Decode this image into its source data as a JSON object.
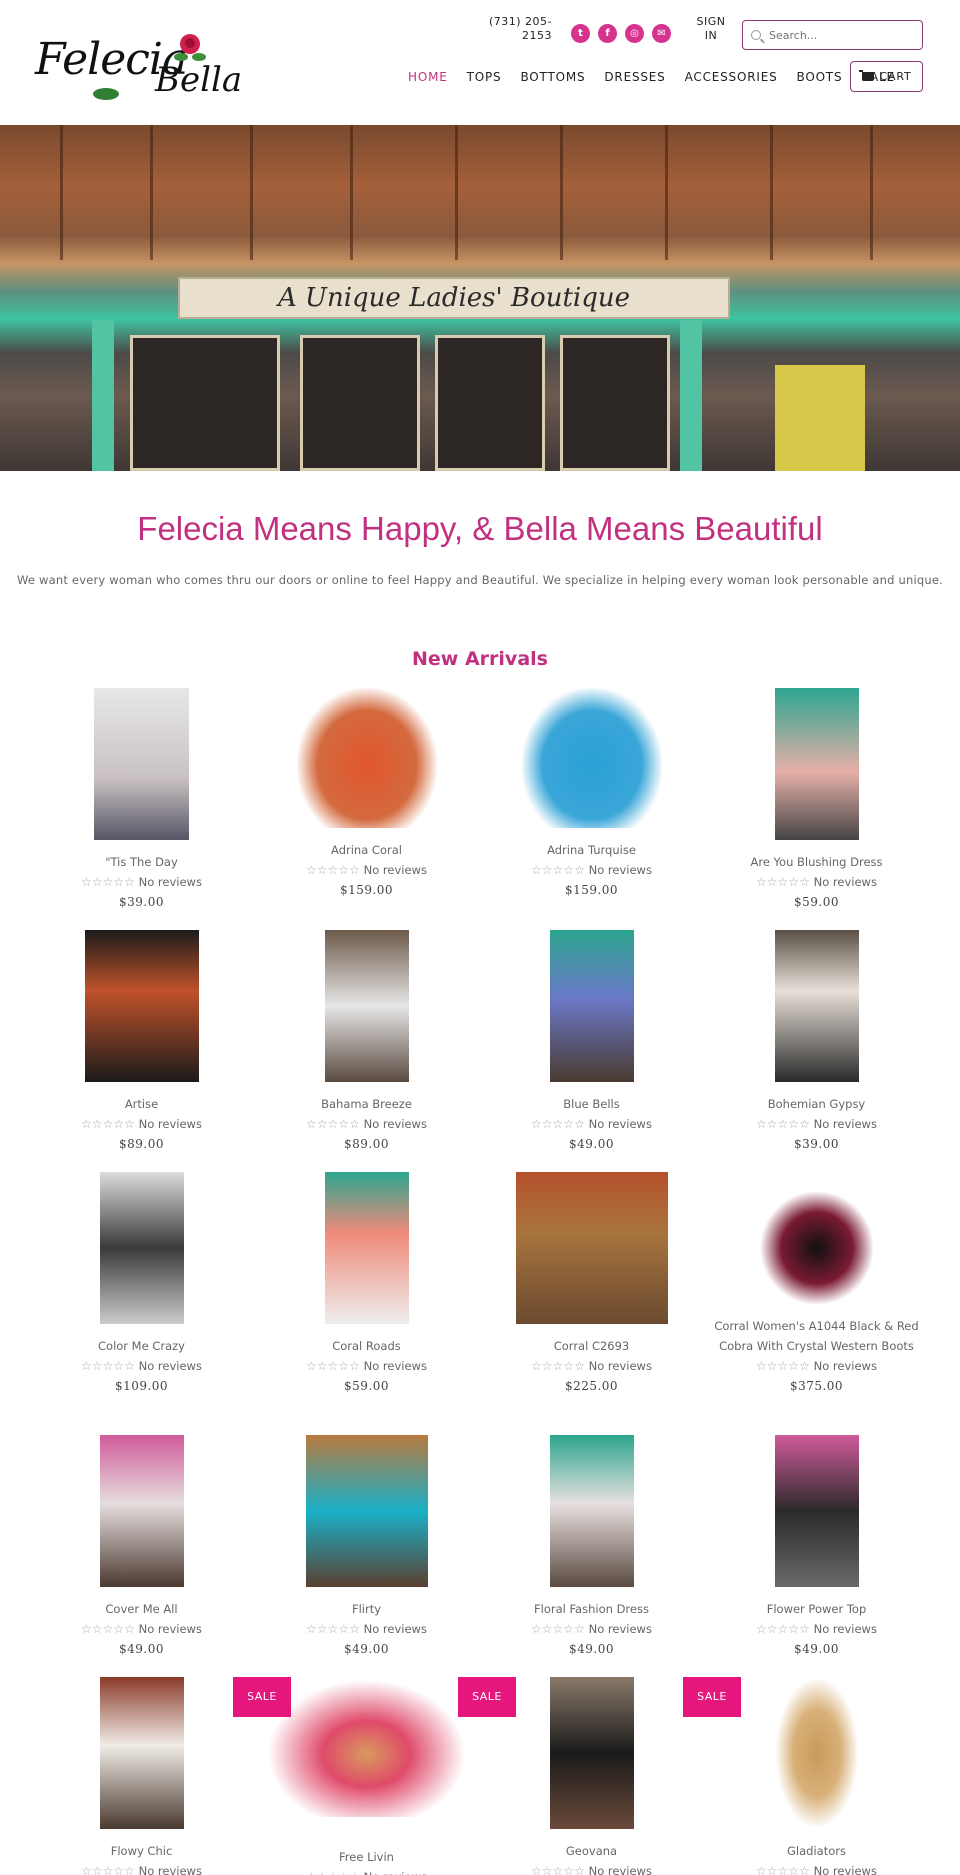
{
  "header": {
    "logo_text_1": "Felecia",
    "logo_text_2": "Bella",
    "phone": "(731) 205-2153",
    "sign_in": "SIGN IN",
    "search_placeholder": "Search...",
    "cart_label": "CART",
    "nav": [
      "HOME",
      "TOPS",
      "BOTTOMS",
      "DRESSES",
      "ACCESSORIES",
      "BOOTS",
      "SALE"
    ]
  },
  "hero": {
    "sign_text": "A Unique Ladies' Boutique"
  },
  "intro": {
    "title": "Felecia Means Happy, & Bella Means Beautiful",
    "text": "We want every woman who comes thru our doors or online to feel Happy and Beautiful. We specialize in helping every woman look personable and unique."
  },
  "section_title": "New Arrivals",
  "review_text": "No reviews",
  "sale_label": "SALE",
  "products": [
    {
      "name": "\"Tis The Day",
      "price": "$39.00",
      "sale": false
    },
    {
      "name": "Adrina Coral",
      "price": "$159.00",
      "sale": false
    },
    {
      "name": "Adrina Turquise",
      "price": "$159.00",
      "sale": false
    },
    {
      "name": "Are You Blushing Dress",
      "price": "$59.00",
      "sale": false
    },
    {
      "name": "Artise",
      "price": "$89.00",
      "sale": false
    },
    {
      "name": "Bahama Breeze",
      "price": "$89.00",
      "sale": false
    },
    {
      "name": "Blue Bells",
      "price": "$49.00",
      "sale": false
    },
    {
      "name": "Bohemian Gypsy",
      "price": "$39.00",
      "sale": false
    },
    {
      "name": "Color Me Crazy",
      "price": "$109.00",
      "sale": false
    },
    {
      "name": "Coral Roads",
      "price": "$59.00",
      "sale": false
    },
    {
      "name": "Corral C2693",
      "price": "$225.00",
      "sale": false
    },
    {
      "name": "Corral Women's A1044 Black & Red Cobra With Crystal Western Boots",
      "price": "$375.00",
      "sale": false
    },
    {
      "name": "Cover Me All",
      "price": "$49.00",
      "sale": false
    },
    {
      "name": "Flirty",
      "price": "$49.00",
      "sale": false
    },
    {
      "name": "Floral Fashion Dress",
      "price": "$49.00",
      "sale": false
    },
    {
      "name": "Flower Power Top",
      "price": "$49.00",
      "sale": false
    },
    {
      "name": "Flowy Chic",
      "price": "",
      "sale": false
    },
    {
      "name": "Free Livin",
      "price": "",
      "sale": true
    },
    {
      "name": "Geovana",
      "price": "",
      "sale": true
    },
    {
      "name": "Gladiators",
      "price": "",
      "sale": true
    }
  ],
  "colors": {
    "accent": "#c2317f",
    "sale_badge": "#e6177c",
    "social": "#d6338e"
  },
  "icons": [
    "twitter-icon",
    "facebook-icon",
    "instagram-icon",
    "mail-icon",
    "search-icon",
    "cart-icon",
    "star-icon"
  ]
}
